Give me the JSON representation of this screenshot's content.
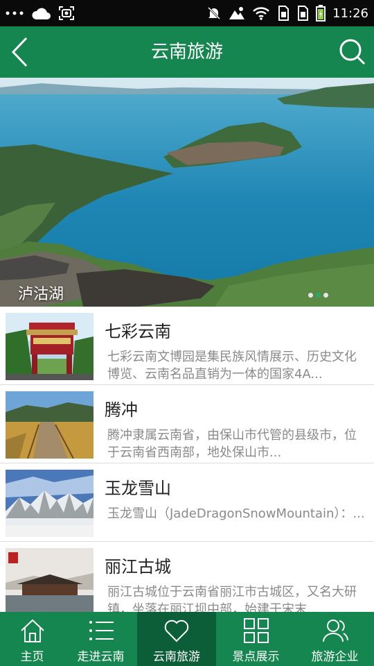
{
  "status_bar": {
    "time": "11:26",
    "icons": [
      "more-dots-icon",
      "cloud-icon",
      "screenshot-icon",
      "mute-icon",
      "weather-icon",
      "wifi-icon",
      "sim1-icon",
      "sim2-icon",
      "battery-icon"
    ]
  },
  "header": {
    "title": "云南旅游",
    "back_icon": "chevron-left-icon",
    "search_icon": "search-icon"
  },
  "banner": {
    "caption": "泸沽湖",
    "slide_count": 3,
    "active_slide": 1
  },
  "list": [
    {
      "title": "七彩云南",
      "desc": "七彩云南文博园是集民族风情展示、历史文化博览、云南名品直销为一体的国家4A..."
    },
    {
      "title": "腾冲",
      "desc": "腾冲隶属云南省，由保山市代管的县级市，位于云南省西南部，地处保山市..."
    },
    {
      "title": "玉龙雪山",
      "desc": "玉龙雪山（JadeDragonSnowMountain）：..."
    },
    {
      "title": "丽江古城",
      "desc": "丽江古城位于云南省丽江市古城区，又名大研镇，坐落在丽江坝中部，始建于宋末..."
    }
  ],
  "bottom_nav": [
    {
      "label": "主页",
      "icon": "home-icon",
      "active": false
    },
    {
      "label": "走进云南",
      "icon": "list-icon",
      "active": false
    },
    {
      "label": "云南旅游",
      "icon": "heart-icon",
      "active": true
    },
    {
      "label": "景点展示",
      "icon": "grid-icon",
      "active": false
    },
    {
      "label": "旅游企业",
      "icon": "users-icon",
      "active": false
    }
  ],
  "colors": {
    "primary": "#15864f",
    "primary_dark": "#0c5e39",
    "status_bar": "#0a0a0a",
    "text_title": "#222222",
    "text_desc": "#8a8a8a"
  }
}
